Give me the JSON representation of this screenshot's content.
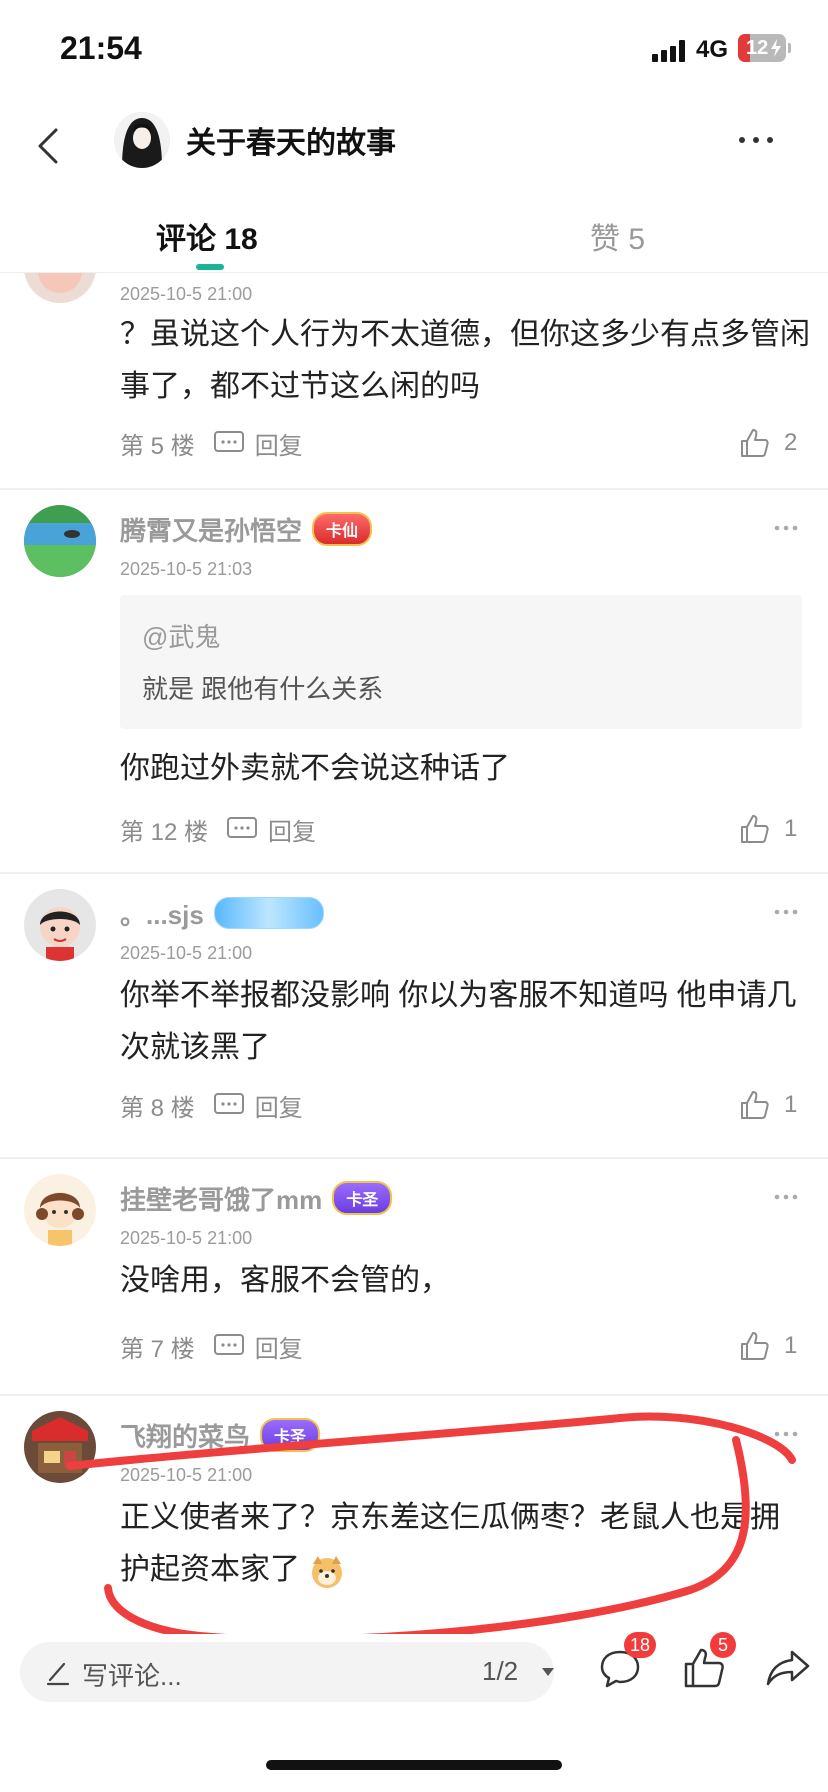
{
  "status_bar": {
    "time": "21:54",
    "network": "4G",
    "battery": "12"
  },
  "header": {
    "title": "关于春天的故事"
  },
  "tabs": [
    {
      "label": "评论 18",
      "active": true
    },
    {
      "label": "赞 5",
      "active": false
    }
  ],
  "comments": [
    {
      "author": "",
      "badge": "",
      "timestamp": "2025-10-5 21:00",
      "text": "？虽说这个人行为不太道德，但你这多少有点多管闲事了，都不过节这么闲的吗",
      "floor": "第 5 楼",
      "reply_label": "回复",
      "likes": "2"
    },
    {
      "author": "腾霄又是孙悟空",
      "badge": "卡仙",
      "timestamp": "2025-10-5 21:03",
      "quote": {
        "user": "@武鬼",
        "text": "就是 跟他有什么关系"
      },
      "text": "你跑过外卖就不会说这种话了",
      "floor": "第 12 楼",
      "reply_label": "回复",
      "likes": "1"
    },
    {
      "author": "。...sjs",
      "badge": "",
      "timestamp": "2025-10-5 21:00",
      "text": "你举不举报都没影响 你以为客服不知道吗 他申请几次就该黑了",
      "floor": "第 8 楼",
      "reply_label": "回复",
      "likes": "1"
    },
    {
      "author": "挂壁老哥饿了mm",
      "badge": "卡圣",
      "timestamp": "2025-10-5 21:00",
      "text": "没啥用，客服不会管的，",
      "floor": "第 7 楼",
      "reply_label": "回复",
      "likes": "1"
    },
    {
      "author": "飞翔的菜鸟",
      "badge": "卡圣",
      "timestamp": "2025-10-5 21:00",
      "text": "正义使者来了？京东差这仨瓜俩枣？老鼠人也是拥护起资本家了"
    }
  ],
  "bottom_bar": {
    "placeholder": "写评论...",
    "page_indicator": "1/2",
    "comment_count": "18",
    "like_count": "5"
  },
  "colors": {
    "accent": "#19b492",
    "badge_red": "#f23c3c",
    "annotation": "#ef3e3e"
  }
}
